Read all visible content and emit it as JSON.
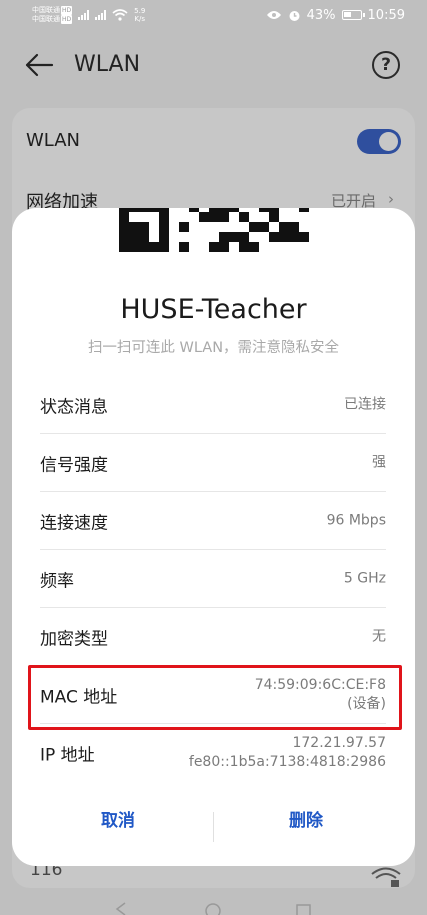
{
  "status_bar": {
    "carrier_1": "中国联通",
    "carrier_2": "中国联通",
    "hd": "HD",
    "net_speed": "5.9",
    "net_speed_unit": "K/s",
    "battery": "43%",
    "time": "10:59"
  },
  "header": {
    "title": "WLAN",
    "help_icon": "?"
  },
  "background_list": {
    "wlan_label": "WLAN",
    "wlan_enabled": true,
    "accel_label": "网络加速",
    "accel_status": "已开启",
    "partial_item": "116"
  },
  "dialog": {
    "ssid": "HUSE-Teacher",
    "hint": "扫一扫可连此 WLAN，需注意隐私安全",
    "rows": [
      {
        "label": "状态消息",
        "value": "已连接"
      },
      {
        "label": "信号强度",
        "value": "强"
      },
      {
        "label": "连接速度",
        "value": "96 Mbps"
      },
      {
        "label": "频率",
        "value": "5 GHz"
      },
      {
        "label": "加密类型",
        "value": "无"
      },
      {
        "label": "MAC 地址",
        "value": "74:59:09:6C:CE:F8",
        "value2": "(设备)"
      },
      {
        "label": "IP 地址",
        "value": "172.21.97.57",
        "value2": "fe80::1b5a:7138:4818:2986"
      }
    ],
    "cancel_label": "取消",
    "delete_label": "删除"
  },
  "colors": {
    "accent": "#2058c6",
    "highlight": "#e0141a",
    "toggle": "#2f4f9e"
  }
}
